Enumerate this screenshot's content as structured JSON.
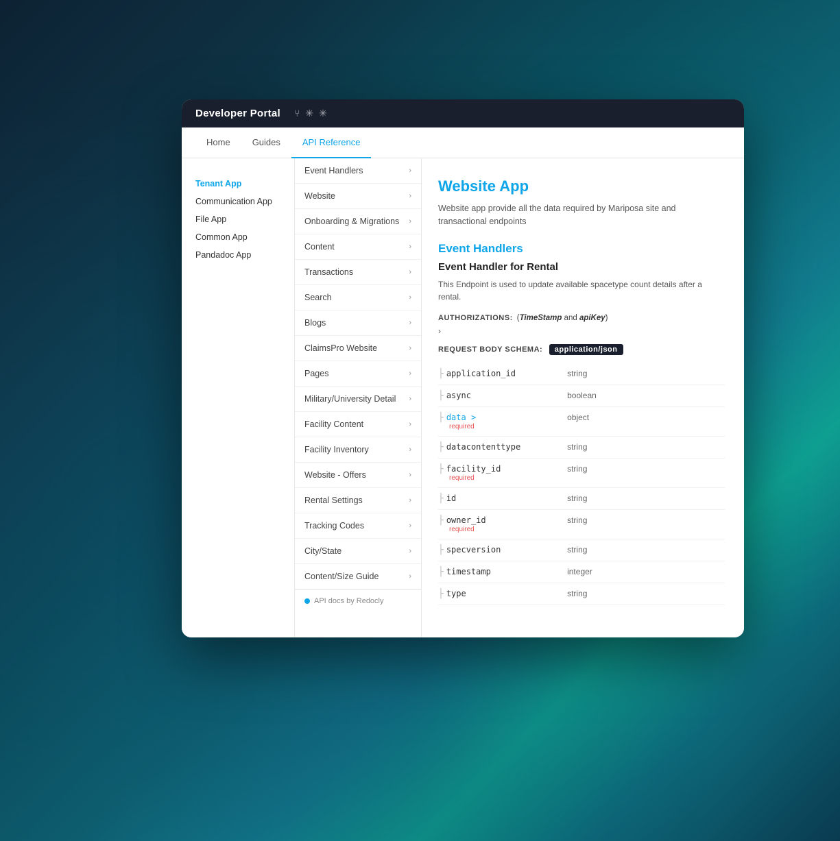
{
  "background": {
    "gradient": "keyboard background"
  },
  "header": {
    "title": "Developer Portal",
    "icons": [
      "⚙",
      "✦",
      "✦"
    ]
  },
  "nav": {
    "tabs": [
      {
        "label": "Home",
        "active": false
      },
      {
        "label": "Guides",
        "active": false
      },
      {
        "label": "API Reference",
        "active": true
      }
    ]
  },
  "sidebar": {
    "items": [
      {
        "label": "Tenant App",
        "active": true
      },
      {
        "label": "Communication App",
        "active": false
      },
      {
        "label": "File App",
        "active": false
      },
      {
        "label": "Common App",
        "active": false
      },
      {
        "label": "Pandadoc App",
        "active": false
      }
    ]
  },
  "middle_nav": {
    "items": [
      {
        "label": "Event Handlers"
      },
      {
        "label": "Website"
      },
      {
        "label": "Onboarding & Migrations"
      },
      {
        "label": "Content"
      },
      {
        "label": "Transactions"
      },
      {
        "label": "Search"
      },
      {
        "label": "Blogs"
      },
      {
        "label": "ClaimsPro Website"
      },
      {
        "label": "Pages"
      },
      {
        "label": "Military/University Detail"
      },
      {
        "label": "Facility Content"
      },
      {
        "label": "Facility Inventory"
      },
      {
        "label": "Website - Offers"
      },
      {
        "label": "Rental Settings"
      },
      {
        "label": "Tracking Codes"
      },
      {
        "label": "City/State"
      },
      {
        "label": "Content/Size Guide"
      }
    ],
    "footer": "API docs by Redocly"
  },
  "right_panel": {
    "app_title": "Website App",
    "app_description": "Website app provide all the data required by Mariposa site and transactional endpoints",
    "section_title": "Event Handlers",
    "subsection_title": "Event Handler for Rental",
    "subsection_desc": "This Endpoint is used to update available spacetype count details after a rental.",
    "authorizations_label": "AUTHORIZATIONS:",
    "authorizations_value": "(TimeStamp and apiKey)",
    "timestamp_text": "TimeStamp",
    "apikey_text": "apiKey",
    "request_body_label": "REQUEST BODY SCHEMA:",
    "request_body_type": "application/json",
    "schema_fields": [
      {
        "name": "application_id",
        "type": "string",
        "required": false,
        "expandable": false
      },
      {
        "name": "async",
        "type": "boolean",
        "required": false,
        "expandable": false
      },
      {
        "name": "data >",
        "type": "object",
        "required": true,
        "expandable": true
      },
      {
        "name": "datacontenttype",
        "type": "string",
        "required": false,
        "expandable": false
      },
      {
        "name": "facility_id",
        "type": "string",
        "required": true,
        "expandable": false
      },
      {
        "name": "id",
        "type": "string",
        "required": false,
        "expandable": false
      },
      {
        "name": "owner_id",
        "type": "string",
        "required": true,
        "expandable": false
      },
      {
        "name": "specversion",
        "type": "string",
        "required": false,
        "expandable": false
      },
      {
        "name": "timestamp",
        "type": "integer",
        "required": false,
        "expandable": false
      },
      {
        "name": "type",
        "type": "string",
        "required": false,
        "expandable": false
      }
    ]
  }
}
